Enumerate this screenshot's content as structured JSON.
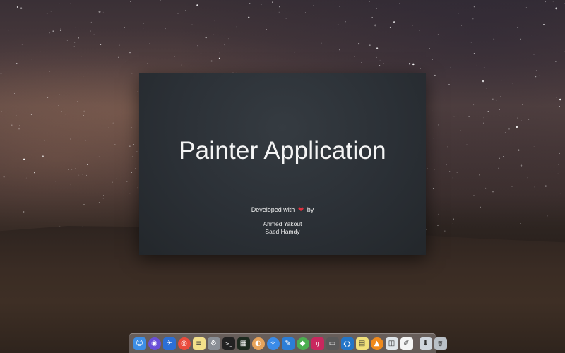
{
  "slide": {
    "title": "Painter Application",
    "developed_prefix": "Developed with",
    "developed_suffix": "by",
    "heart_glyph": "❤",
    "authors": [
      "Ahmed Yakout",
      "Saed Hamdy"
    ]
  },
  "dock": {
    "apps": [
      {
        "name": "finder-icon",
        "bg": "#3d8ee6",
        "glyph": "☺"
      },
      {
        "name": "siri-icon",
        "bg": "#6a4fd8",
        "glyph": "◉"
      },
      {
        "name": "launchpad-icon",
        "bg": "#2b6fd6",
        "glyph": "✈"
      },
      {
        "name": "chrome-icon",
        "bg": "#e94b3c",
        "glyph": "◎"
      },
      {
        "name": "notes-icon",
        "bg": "#f3e08a",
        "glyph": "≡"
      },
      {
        "name": "system-preferences-icon",
        "bg": "#8a8f96",
        "glyph": "⚙"
      },
      {
        "name": "terminal-icon",
        "bg": "#222222",
        "glyph": ">_"
      },
      {
        "name": "activity-monitor-icon",
        "bg": "#1d2a1f",
        "glyph": "▦"
      },
      {
        "name": "preview-icon",
        "bg": "#e7a35a",
        "glyph": "◐"
      },
      {
        "name": "safari-icon",
        "bg": "#3a8be8",
        "glyph": "✧"
      },
      {
        "name": "xcode-icon",
        "bg": "#2c7ed6",
        "glyph": "✎"
      },
      {
        "name": "android-studio-icon",
        "bg": "#4caf50",
        "glyph": "◆"
      },
      {
        "name": "intellij-icon",
        "bg": "#c9285e",
        "glyph": "IJ"
      },
      {
        "name": "photos-icon",
        "bg": "#5a5a5a",
        "glyph": "▭"
      },
      {
        "name": "vscode-icon",
        "bg": "#2376c8",
        "glyph": "❮❯"
      },
      {
        "name": "stickies-icon",
        "bg": "#f1e07a",
        "glyph": "▤"
      },
      {
        "name": "vlc-icon",
        "bg": "#f08a1c",
        "glyph": "▲"
      },
      {
        "name": "app-store-icon",
        "bg": "#dfe5ea",
        "glyph": "◫"
      },
      {
        "name": "textedit-icon",
        "bg": "#f5f5f5",
        "glyph": "✐"
      }
    ],
    "trailing": [
      {
        "name": "downloads-icon",
        "bg": "#cfd6de",
        "glyph": "⬇"
      },
      {
        "name": "trash-icon",
        "bg": "#b9c0c7",
        "glyph": "🗑"
      }
    ]
  }
}
